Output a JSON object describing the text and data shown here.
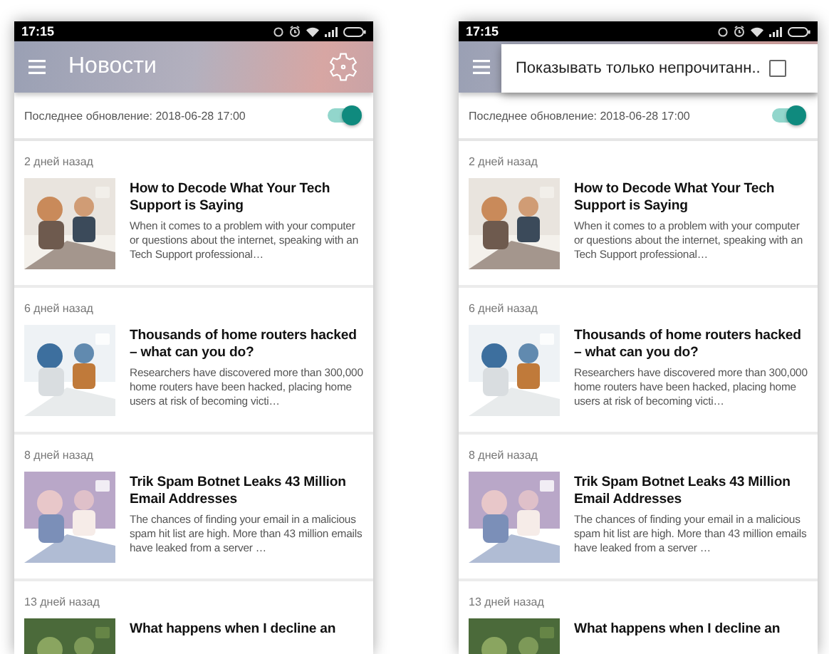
{
  "phones": [
    {
      "status_time": "17:15",
      "app_title": "Новости",
      "update": {
        "label": "Последнее обновление: 2018-06-28 17:00",
        "on": true
      },
      "news": [
        {
          "age": "2 дней назад",
          "title": "How to Decode What Your Tech Support is Saying",
          "summary": "When it comes to a problem with your computer or questions about the internet, speaking with an Tech Support professional…"
        },
        {
          "age": "6 дней назад",
          "title": "Thousands of home routers hacked – what can you do?",
          "summary": "Researchers have discovered more than 300,000 home routers have been hacked, placing home users at risk of becoming victi…"
        },
        {
          "age": "8 дней назад",
          "title": "Trik Spam Botnet Leaks 43 Million Email Addresses",
          "summary": "The chances of finding your email in a malicious spam hit list are high. More than 43 million emails have leaked from a server …"
        },
        {
          "age": "13 дней назад",
          "title": "What happens when I decline an"
        }
      ]
    },
    {
      "status_time": "17:15",
      "popup_menu": {
        "label": "Показывать только непрочитанн..",
        "checked": false
      },
      "update": {
        "label": "Последнее обновление: 2018-06-28 17:00",
        "on": true
      },
      "news": [
        {
          "age": "2 дней назад",
          "title": "How to Decode What Your Tech Support is Saying",
          "summary": "When it comes to a problem with your computer or questions about the internet, speaking with an Tech Support professional…"
        },
        {
          "age": "6 дней назад",
          "title": "Thousands of home routers hacked – what can you do?",
          "summary": "Researchers have discovered more than 300,000 home routers have been hacked, placing home users at risk of becoming victi…"
        },
        {
          "age": "8 дней назад",
          "title": "Trik Spam Botnet Leaks 43 Million Email Addresses",
          "summary": "The chances of finding your email in a malicious spam hit list are high. More than 43 million emails have leaked from a server …"
        },
        {
          "age": "13 дней назад",
          "title": "What happens when I decline an"
        }
      ]
    }
  ]
}
